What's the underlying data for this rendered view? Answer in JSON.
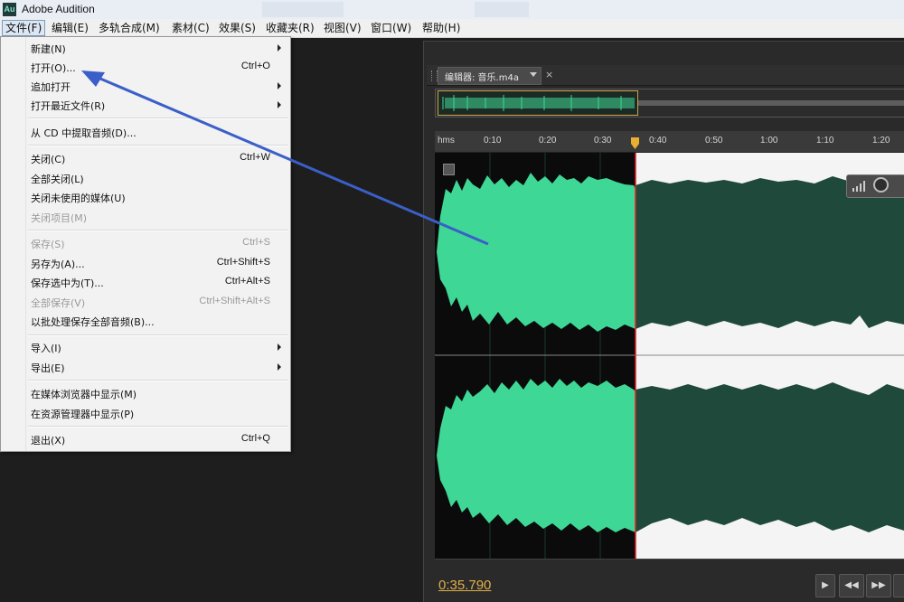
{
  "window": {
    "title": "Adobe Audition",
    "app_icon": "Au"
  },
  "menubar": {
    "items": [
      {
        "label": "文件(F)"
      },
      {
        "label": "编辑(E)"
      },
      {
        "label": "多轨合成(M)"
      },
      {
        "label": "素材(C)"
      },
      {
        "label": "效果(S)"
      },
      {
        "label": "收藏夹(R)"
      },
      {
        "label": "视图(V)"
      },
      {
        "label": "窗口(W)"
      },
      {
        "label": "帮助(H)"
      }
    ]
  },
  "file_menu": {
    "items": [
      {
        "label": "新建(N)",
        "shortcut": ""
      },
      {
        "label": "打开(O)...",
        "shortcut": "Ctrl+O"
      },
      {
        "label": "追加打开",
        "shortcut": ""
      },
      {
        "label": "打开最近文件(R)",
        "shortcut": ""
      },
      {
        "label": "从 CD 中提取音频(D)...",
        "shortcut": ""
      },
      {
        "label": "关闭(C)",
        "shortcut": "Ctrl+W"
      },
      {
        "label": "全部关闭(L)",
        "shortcut": ""
      },
      {
        "label": "关闭未使用的媒体(U)",
        "shortcut": ""
      },
      {
        "label": "关闭项目(M)",
        "shortcut": ""
      },
      {
        "label": "保存(S)",
        "shortcut": "Ctrl+S"
      },
      {
        "label": "另存为(A)...",
        "shortcut": "Ctrl+Shift+S"
      },
      {
        "label": "保存选中为(T)...",
        "shortcut": "Ctrl+Alt+S"
      },
      {
        "label": "全部保存(V)",
        "shortcut": "Ctrl+Shift+Alt+S"
      },
      {
        "label": "以批处理保存全部音频(B)...",
        "shortcut": ""
      },
      {
        "label": "导入(I)",
        "shortcut": ""
      },
      {
        "label": "导出(E)",
        "shortcut": ""
      },
      {
        "label": "在媒体浏览器中显示(M)",
        "shortcut": ""
      },
      {
        "label": "在资源管理器中显示(P)",
        "shortcut": ""
      },
      {
        "label": "退出(X)",
        "shortcut": "Ctrl+Q"
      }
    ]
  },
  "editor": {
    "tab_label": "编辑器: 音乐.m4a",
    "close_glyph": "×",
    "ruler_labels": [
      "hms",
      "0:10",
      "0:20",
      "0:30",
      "0:40",
      "0:50",
      "1:00",
      "1:10",
      "1:20"
    ],
    "current_time": "0:35.790"
  },
  "transport": {
    "rewind_glyph": "◀◀",
    "forward_glyph": "▶▶",
    "play_glyph": "▶"
  },
  "colors": {
    "waveform_selected": "#3fd796",
    "waveform_dark": "#1f4a3b",
    "playhead": "#e02020",
    "time": "#e0b04a",
    "annotation_arrow": "#3a5fc8"
  }
}
